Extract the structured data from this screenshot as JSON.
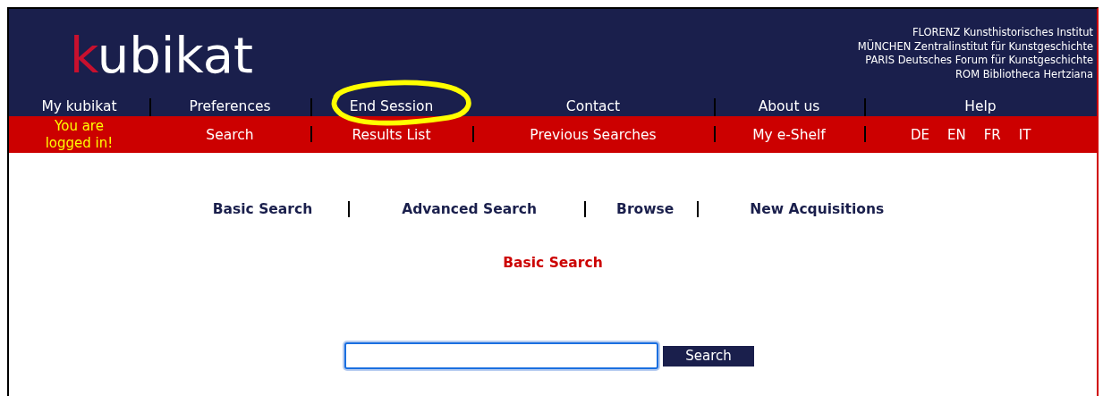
{
  "logo": {
    "first_letter": "k",
    "rest": "ubikat"
  },
  "institutes": [
    "FLORENZ Kunsthistorisches Institut",
    "MÜNCHEN Zentralinstitut für Kunstgeschichte",
    "PARIS Deutsches Forum für Kunstgeschichte",
    "ROM Bibliotheca Hertziana"
  ],
  "top_nav": [
    {
      "label": "My kubikat",
      "divider_before": false
    },
    {
      "label": "Preferences",
      "divider_before": true
    },
    {
      "label": "End Session",
      "divider_before": true,
      "highlighted": true
    },
    {
      "label": "Contact",
      "divider_before": false
    },
    {
      "label": "About us",
      "divider_before": true
    },
    {
      "label": "Help",
      "divider_before": true
    }
  ],
  "login_status": "You are logged in!",
  "second_nav": [
    {
      "label": "Search",
      "divider_before": false
    },
    {
      "label": "Results List",
      "divider_before": true
    },
    {
      "label": "Previous Searches",
      "divider_before": true
    },
    {
      "label": "My e-Shelf",
      "divider_before": true
    }
  ],
  "languages": [
    "DE",
    "EN",
    "FR",
    "IT"
  ],
  "search_tabs": [
    {
      "label": "Basic Search"
    },
    {
      "label": "Advanced Search"
    },
    {
      "label": "Browse"
    },
    {
      "label": "New Acquisitions"
    }
  ],
  "heading": "Basic Search",
  "search_form": {
    "button": "Search"
  }
}
